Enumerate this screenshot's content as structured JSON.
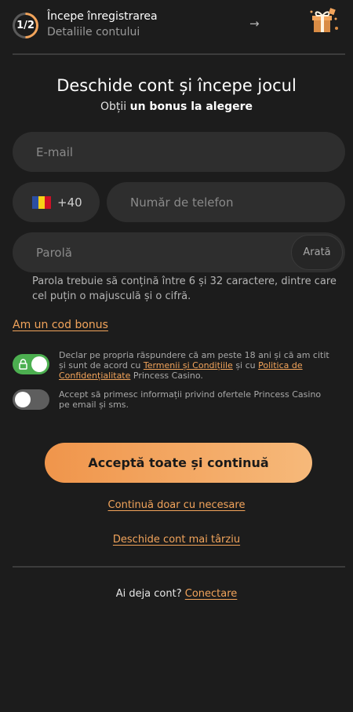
{
  "header": {
    "step": "1/2",
    "title": "Începe înregistrarea",
    "subtitle": "Detaliile contului",
    "arrow": "→",
    "gift_icon": "gift-icon"
  },
  "heading": {
    "title": "Deschide cont și începe jocul",
    "subtitle_prefix": "Obții",
    "subtitle_bold": "un bonus la alegere"
  },
  "form": {
    "email_placeholder": "E-mail",
    "country_code": "+40",
    "flag_colors": [
      "#2b4ea2",
      "#f7d117",
      "#ce1126"
    ],
    "phone_placeholder": "Număr de telefon",
    "password_placeholder": "Parolă",
    "show_label": "Arată",
    "password_hint": "Parola trebuie să conțină între 6 și 32 caractere, dintre care cel puțin o majusculă și o cifră."
  },
  "bonus_link": "Am un cod bonus",
  "consents": [
    {
      "enabled": true,
      "locked": true,
      "text_before": "Declar pe propria răspundere că am peste 18 ani și că am citit și sunt de acord cu ",
      "link1": "Termenii și Condițiile",
      "text_mid": " și cu ",
      "link2": "Politica de Confidențialitate",
      "text_after": " Princess Casino."
    },
    {
      "enabled": false,
      "text": "Accept să primesc informații privind ofertele Princess Casino pe email și sms."
    }
  ],
  "buttons": {
    "accept_all": "Acceptă toate și continuă",
    "necessary_only": "Continuă doar cu necesare",
    "later": "Deschide cont mai târziu"
  },
  "footer": {
    "question": "Ai deja cont?",
    "login": "Conectare"
  },
  "colors": {
    "accent": "#f2a45b",
    "toggle_on": "#4caf50",
    "background": "#1c1c1c",
    "input_bg": "#2e2e2e"
  }
}
